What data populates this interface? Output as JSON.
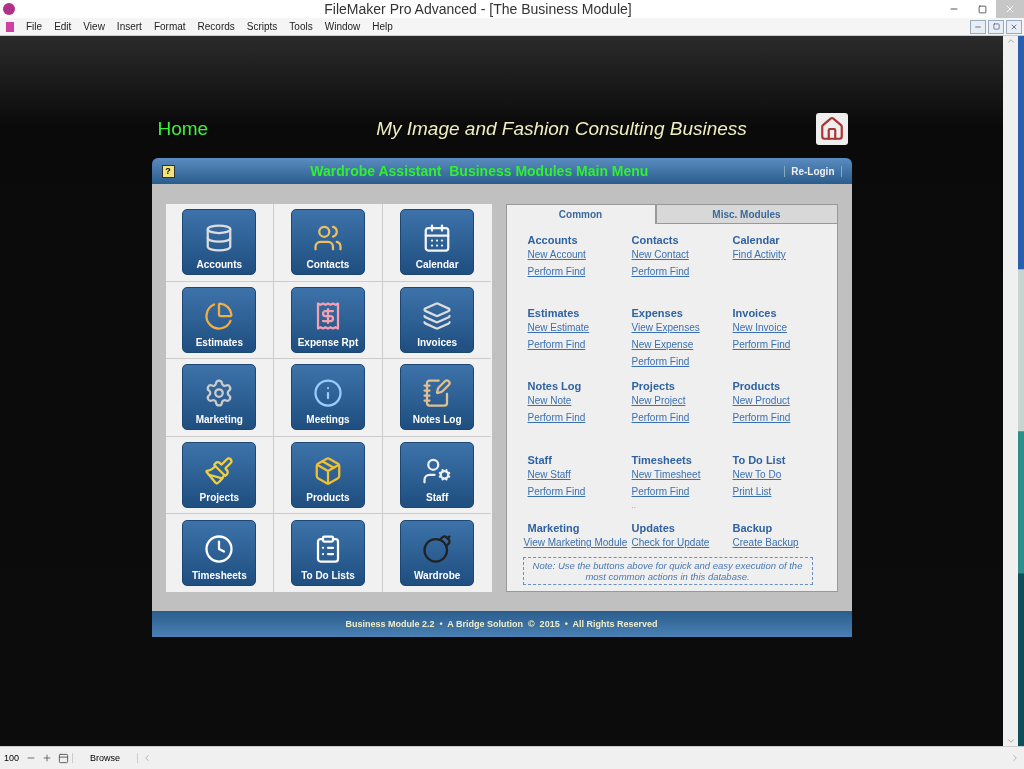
{
  "window": {
    "title": "FileMaker Pro Advanced - [The Business Module]"
  },
  "menu": [
    "File",
    "Edit",
    "View",
    "Insert",
    "Format",
    "Records",
    "Scripts",
    "Tools",
    "Window",
    "Help"
  ],
  "header": {
    "home": "Home",
    "title": "My Image and Fashion Consulting Business"
  },
  "panel": {
    "title": "Wardrobe Assistant  Business Modules Main Menu",
    "help": "?",
    "relogin": "Re-Login",
    "footer": "Business Module 2.2  •  A Bridge Solution  ©  2015  •  All Rights Reserved"
  },
  "modules": [
    {
      "label": "Accounts"
    },
    {
      "label": "Contacts"
    },
    {
      "label": "Calendar"
    },
    {
      "label": "Estimates"
    },
    {
      "label": "Expense Rpt"
    },
    {
      "label": "Invoices"
    },
    {
      "label": "Marketing"
    },
    {
      "label": "Meetings"
    },
    {
      "label": "Notes Log"
    },
    {
      "label": "Projects"
    },
    {
      "label": "Products"
    },
    {
      "label": "Staff"
    },
    {
      "label": "Timesheets"
    },
    {
      "label": "To Do Lists"
    },
    {
      "label": "Wardrobe"
    }
  ],
  "tabs": [
    {
      "label": "Common",
      "selected": true
    },
    {
      "label": "Misc. Modules",
      "selected": false
    }
  ],
  "sections": [
    {
      "title": "Accounts",
      "links": [
        "New Account",
        "Perform Find"
      ]
    },
    {
      "title": "Contacts",
      "links": [
        "New Contact",
        "Perform Find"
      ]
    },
    {
      "title": "Calendar",
      "links": [
        "Find Activity"
      ]
    },
    {
      "title": "Estimates",
      "links": [
        "New Estimate",
        "Perform Find"
      ]
    },
    {
      "title": "Expenses",
      "links": [
        "View Expenses",
        "New Expense",
        "Perform Find"
      ]
    },
    {
      "title": "Invoices",
      "links": [
        "New Invoice",
        "Perform Find"
      ]
    },
    {
      "title": "Notes Log",
      "links": [
        "New Note",
        "Perform Find"
      ]
    },
    {
      "title": "Projects",
      "links": [
        "New Project",
        "Perform Find"
      ]
    },
    {
      "title": "Products",
      "links": [
        "New Product",
        "Perform Find"
      ]
    },
    {
      "title": "Staff",
      "links": [
        "New Staff",
        "Perform Find"
      ]
    },
    {
      "title": "Timesheets",
      "links": [
        "New Timesheet",
        "Perform Find"
      ],
      "trailing": ".."
    },
    {
      "title": "To Do List",
      "links": [
        "New To Do",
        "Print List"
      ]
    },
    {
      "title": "Marketing",
      "links": [
        "View Marketing Module"
      ]
    },
    {
      "title": "Updates",
      "links": [
        "Check for Update"
      ]
    },
    {
      "title": "Backup",
      "links": [
        "Create Backup"
      ]
    }
  ],
  "note": "Note: Use the buttons above for quick and easy execution of the most common actions in this database.",
  "status_bar": {
    "zoom": "100",
    "mode": "Browse"
  }
}
